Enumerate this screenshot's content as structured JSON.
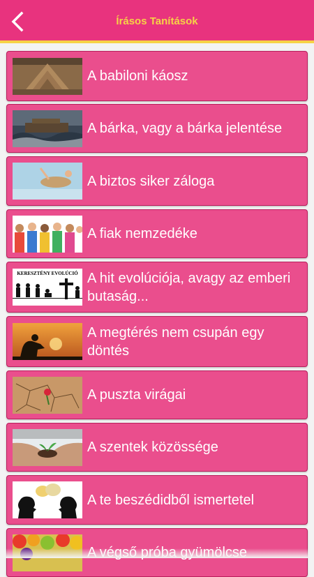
{
  "header": {
    "title": "Írásos Tanítások",
    "back_icon": "chevron-left-icon",
    "bg_color": "#e8337e",
    "accent_color": "#f6d246"
  },
  "list": {
    "items": [
      {
        "label": "A babiloni káosz"
      },
      {
        "label": "A bárka, vagy a bárka jelentése"
      },
      {
        "label": "A biztos siker záloga"
      },
      {
        "label": "A fiak nemzedéke"
      },
      {
        "label": "A hit evolúciója, avagy az emberi butaság...",
        "thumb_text": "KERESZTÉNY EVOLÚCIÓ"
      },
      {
        "label": "A megtérés nem csupán egy döntés"
      },
      {
        "label": "A puszta virágai"
      },
      {
        "label": "A szentek közössége"
      },
      {
        "label": "A te beszédidből ismertetel"
      },
      {
        "label": "A végső próba gyümölcse"
      }
    ],
    "item_color": "#ea4e8d"
  }
}
